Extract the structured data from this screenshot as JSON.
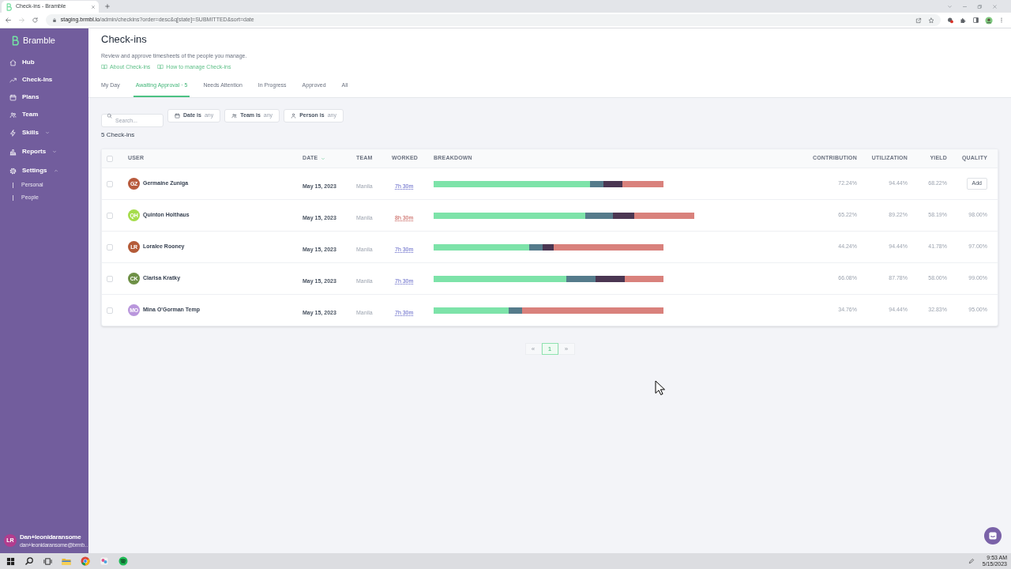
{
  "browser": {
    "tab": {
      "title": "Check-ins - Bramble"
    },
    "url": {
      "host": "staging.brmbl.io",
      "path": "/admin/checkins?order=desc&q[state]=SUBMITTED&sort=date"
    }
  },
  "sidebar": {
    "brand": "Bramble",
    "items": [
      {
        "kind": "link",
        "label": "Hub"
      },
      {
        "kind": "link",
        "label": "Check-Ins"
      },
      {
        "kind": "link",
        "label": "Plans"
      },
      {
        "kind": "link",
        "label": "Team"
      },
      {
        "kind": "group",
        "label": "Skills",
        "expanded": false
      },
      {
        "kind": "group",
        "label": "Reports",
        "expanded": false
      },
      {
        "kind": "group",
        "label": "Settings",
        "expanded": true,
        "children": [
          {
            "label": "Personal"
          },
          {
            "label": "People"
          }
        ]
      }
    ],
    "user": {
      "initials": "LR",
      "color": "#b23d8e",
      "name": "Dan+leonidaransome",
      "email": "dan+leonidaransome@brmb…"
    }
  },
  "header": {
    "title": "Check-ins",
    "description": "Review and approve timesheets of the people you manage.",
    "help_links": [
      {
        "label": "About Check-ins"
      },
      {
        "label": "How to manage Check-ins"
      }
    ],
    "tabs": [
      {
        "label": "My Day",
        "selected": false
      },
      {
        "label": "Awaiting Approval · 5",
        "selected": true
      },
      {
        "label": "Needs Attention",
        "selected": false
      },
      {
        "label": "In Progress",
        "selected": false
      },
      {
        "label": "Approved",
        "selected": false
      },
      {
        "label": "All",
        "selected": false
      }
    ]
  },
  "filters": {
    "search": {
      "placeholder": "Search..."
    },
    "buttons": [
      {
        "label": "Date is",
        "value": "any"
      },
      {
        "label": "Team is",
        "value": "any"
      },
      {
        "label": "Person is",
        "value": "any"
      }
    ]
  },
  "count": "5 Check-ins",
  "table": {
    "select_all": {
      "checked": false
    },
    "columns": [
      {
        "label": "USER",
        "sorted": false
      },
      {
        "label": "DATE",
        "sorted": true
      },
      {
        "label": "TEAM",
        "sorted": false
      },
      {
        "label": "WORKED",
        "sorted": false
      },
      {
        "label": "BREAKDOWN",
        "sorted": false
      },
      {
        "label": "CONTRIBUTION",
        "sorted": false
      },
      {
        "label": "UTILIZATION",
        "sorted": false
      },
      {
        "label": "YIELD",
        "sorted": false
      },
      {
        "label": "QUALITY",
        "sorted": false
      }
    ],
    "rows": [
      {
        "checked": false,
        "avatar": {
          "initials": "GZ",
          "color": "#b85a3c"
        },
        "name": "Germaine Zuniga",
        "date": "May 15, 2023",
        "team": "Manila",
        "worked": "7h 30m",
        "overtime": false,
        "contribution": "72.24%",
        "utilization": "94.44%",
        "yield": "68.22%",
        "quality": {
          "kind": "button",
          "label": "Add"
        }
      },
      {
        "checked": false,
        "avatar": {
          "initials": "QH",
          "color": "#a5dc4b"
        },
        "name": "Quinton Holthaus",
        "date": "May 15, 2023",
        "team": "Manila",
        "worked": "8h 30m",
        "overtime": true,
        "contribution": "65.22%",
        "utilization": "89.22%",
        "yield": "58.19%",
        "quality": {
          "kind": "text",
          "label": "98.00%"
        }
      },
      {
        "checked": false,
        "avatar": {
          "initials": "LR",
          "color": "#b45b38"
        },
        "name": "Loralee Rooney",
        "date": "May 15, 2023",
        "team": "Manila",
        "worked": "7h 30m",
        "overtime": false,
        "contribution": "44.24%",
        "utilization": "94.44%",
        "yield": "41.78%",
        "quality": {
          "kind": "text",
          "label": "97.00%"
        }
      },
      {
        "checked": false,
        "avatar": {
          "initials": "CK",
          "color": "#6e9046"
        },
        "name": "Clarisa Kratky",
        "date": "May 15, 2023",
        "team": "Manila",
        "worked": "7h 30m",
        "overtime": false,
        "contribution": "66.08%",
        "utilization": "87.78%",
        "yield": "58.00%",
        "quality": {
          "kind": "text",
          "label": "99.00%"
        }
      },
      {
        "checked": false,
        "avatar": {
          "initials": "MO",
          "color": "#b996dc"
        },
        "name": "Mina O'Gorman Temp",
        "date": "May 15, 2023",
        "team": "Manila",
        "worked": "7h 30m",
        "overtime": false,
        "contribution": "34.76%",
        "utilization": "94.44%",
        "yield": "32.83%",
        "quality": {
          "kind": "text",
          "label": "95.00%"
        }
      }
    ]
  },
  "pagination": {
    "previous": {
      "label": "«",
      "disabled": true
    },
    "pages": [
      {
        "label": "1",
        "selected": true
      }
    ],
    "next": {
      "label": "»",
      "disabled": true
    }
  },
  "taskbar": {
    "time": "9:53 AM",
    "date": "5/15/2023"
  }
}
